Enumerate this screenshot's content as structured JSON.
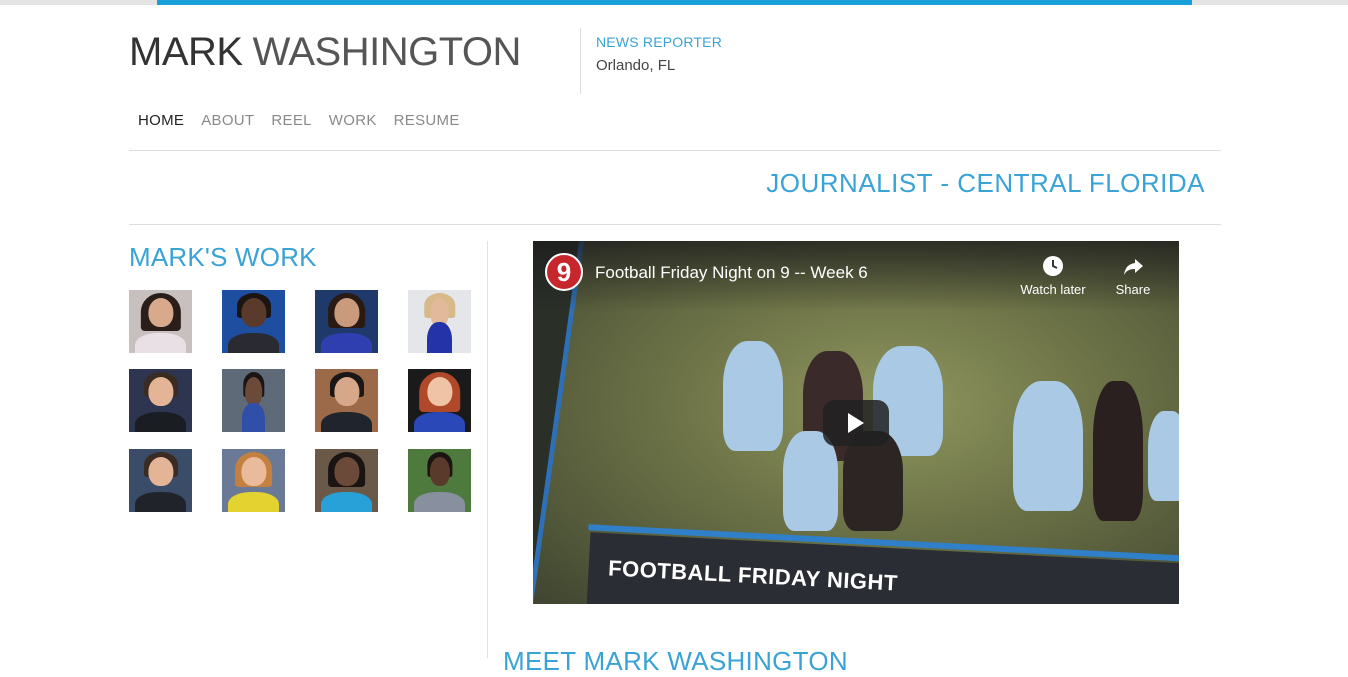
{
  "brand": {
    "first_name": "MARK",
    "last_name": "WASHINGTON"
  },
  "header": {
    "role": "NEWS REPORTER",
    "location": "Orlando, FL"
  },
  "nav": {
    "items": [
      {
        "label": "HOME",
        "active": true
      },
      {
        "label": "ABOUT",
        "active": false
      },
      {
        "label": "REEL",
        "active": false
      },
      {
        "label": "WORK",
        "active": false
      },
      {
        "label": "RESUME",
        "active": false
      }
    ]
  },
  "tagline": "JOURNALIST - CENTRAL FLORIDA",
  "work": {
    "title": "MARK'S WORK",
    "thumbnails": [
      {
        "name": "thumb-1"
      },
      {
        "name": "thumb-2"
      },
      {
        "name": "thumb-3"
      },
      {
        "name": "thumb-4"
      },
      {
        "name": "thumb-5"
      },
      {
        "name": "thumb-6"
      },
      {
        "name": "thumb-7"
      },
      {
        "name": "thumb-8"
      },
      {
        "name": "thumb-9"
      },
      {
        "name": "thumb-10"
      },
      {
        "name": "thumb-11"
      },
      {
        "name": "thumb-12"
      }
    ]
  },
  "video": {
    "channel_logo": "9",
    "title": "Football Friday Night on 9 -- Week 6",
    "watch_later": "Watch later",
    "share": "Share",
    "banner": "FOOTBALL FRIDAY NIGHT",
    "icons": {
      "watch_later": "clock-icon",
      "share": "share-arrow-icon",
      "play": "play-icon"
    }
  },
  "meet_heading": "MEET MARK WASHINGTON",
  "colors": {
    "accent": "#3aa3d6",
    "topbar_accent": "#1aa0d8",
    "nav_active": "#222222",
    "nav_inactive": "#8a8a8a"
  }
}
